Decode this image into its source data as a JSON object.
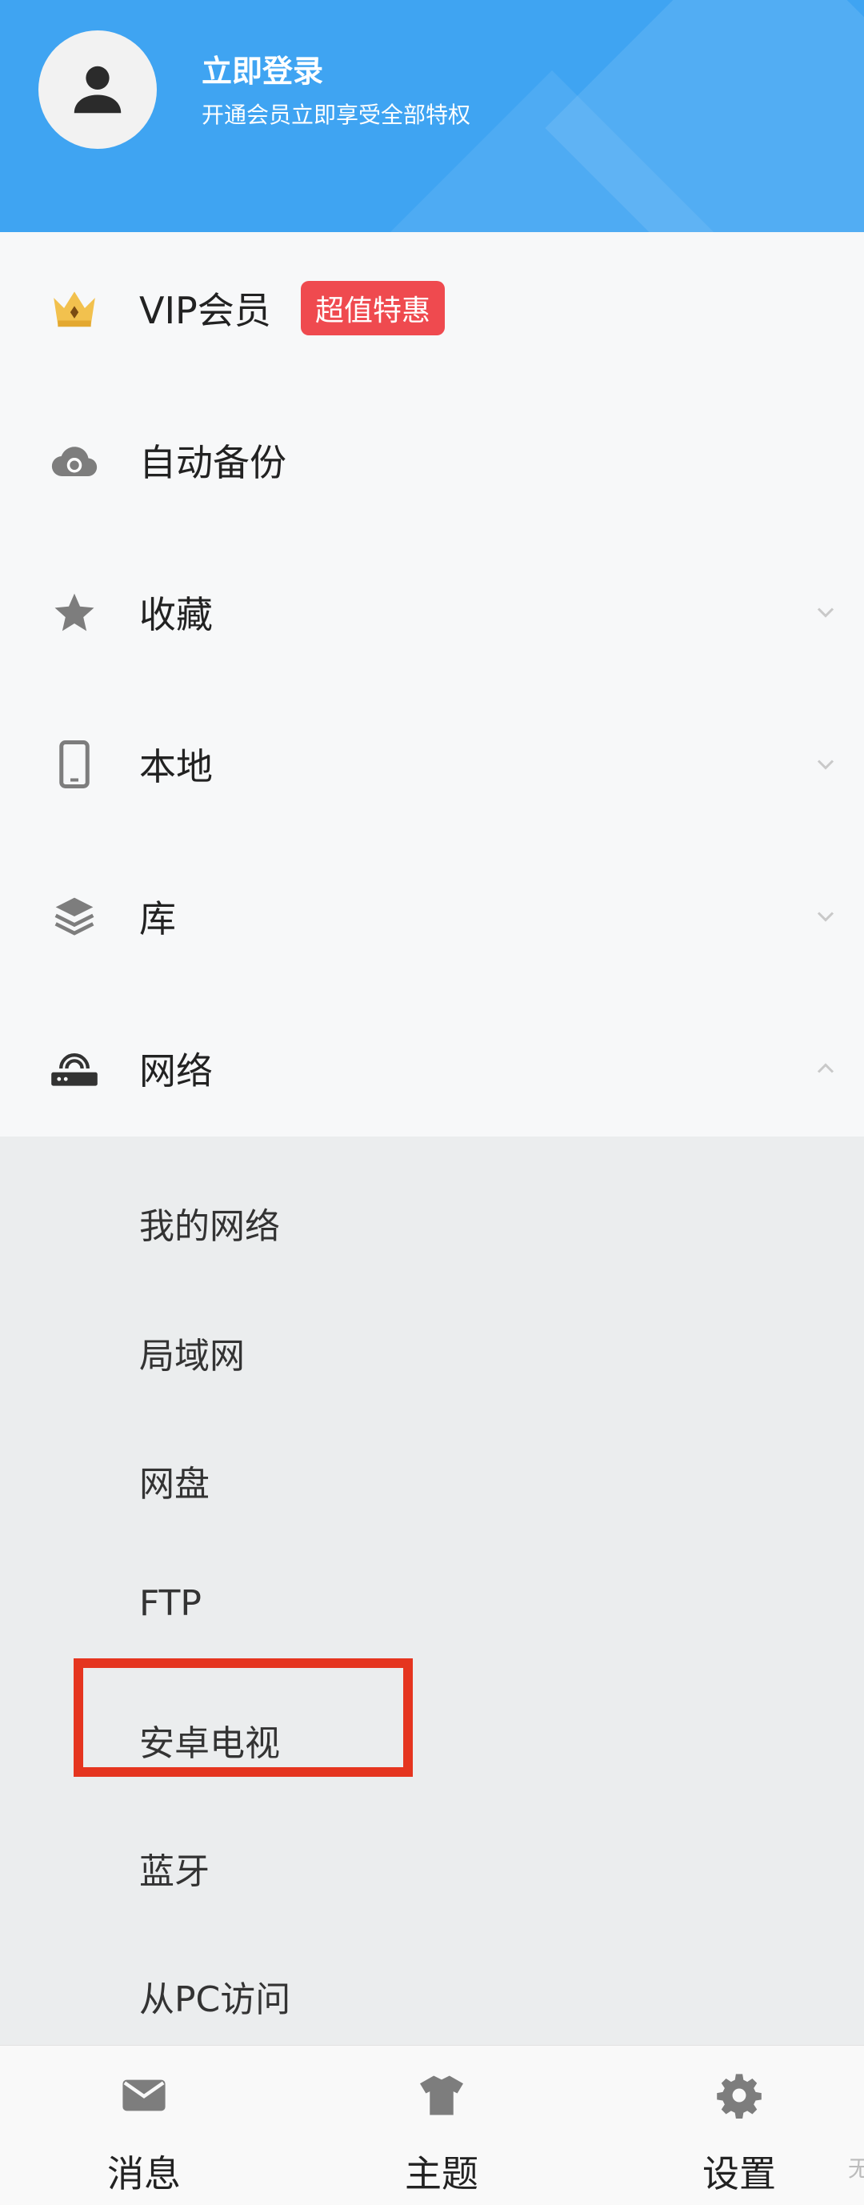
{
  "header": {
    "title": "立即登录",
    "subtitle": "开通会员立即享受全部特权",
    "icon": "user-avatar-icon"
  },
  "menu": {
    "vip": {
      "label": "VIP会员",
      "badge": "超值特惠",
      "icon": "crown-icon"
    },
    "backup": {
      "label": "自动备份",
      "icon": "cloud-sync-icon"
    },
    "favorites": {
      "label": "收藏",
      "icon": "star-icon"
    },
    "local": {
      "label": "本地",
      "icon": "phone-icon"
    },
    "library": {
      "label": "库",
      "icon": "layers-icon"
    },
    "network": {
      "label": "网络",
      "icon": "router-icon"
    }
  },
  "network_submenu": [
    {
      "label": "我的网络"
    },
    {
      "label": "局域网"
    },
    {
      "label": "网盘"
    },
    {
      "label": "FTP"
    },
    {
      "label": "安卓电视"
    },
    {
      "label": "蓝牙"
    },
    {
      "label": "从PC访问"
    }
  ],
  "bottom_tabs": [
    {
      "label": "消息",
      "icon": "mail-icon"
    },
    {
      "label": "主题",
      "icon": "shirt-icon"
    },
    {
      "label": "设置",
      "icon": "gear-icon"
    }
  ],
  "edge_text": "无",
  "colors": {
    "header_bg": "#3fa4f2",
    "badge_bg": "#ef4a4f",
    "highlight": "#e5351f",
    "crown": "#f2c14e"
  }
}
